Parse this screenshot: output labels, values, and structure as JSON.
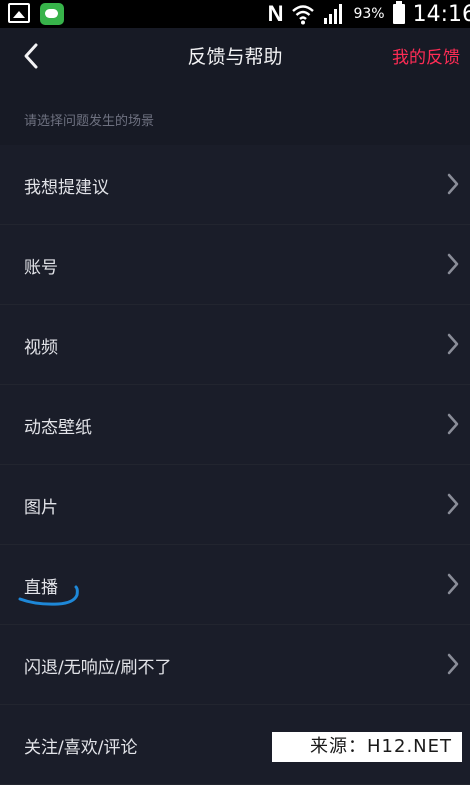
{
  "status_bar": {
    "nfc_label": "N",
    "battery_percent": "93%",
    "time": "14:16",
    "battery_level": 0.93
  },
  "header": {
    "back_icon": "chevron-left-icon",
    "title": "反馈与帮助",
    "right_action": "我的反馈"
  },
  "section_hint": "请选择问题发生的场景",
  "items": [
    {
      "label": "我想提建议"
    },
    {
      "label": "账号"
    },
    {
      "label": "视频"
    },
    {
      "label": "动态壁纸"
    },
    {
      "label": "图片"
    },
    {
      "label": "直播"
    },
    {
      "label": "闪退/无响应/刷不了"
    },
    {
      "label": "关注/喜欢/评论"
    }
  ],
  "watermark": "来源：H12.NET",
  "colors": {
    "background": "#171a25",
    "accent": "#fe2c55",
    "annotation": "#1e88d8"
  }
}
